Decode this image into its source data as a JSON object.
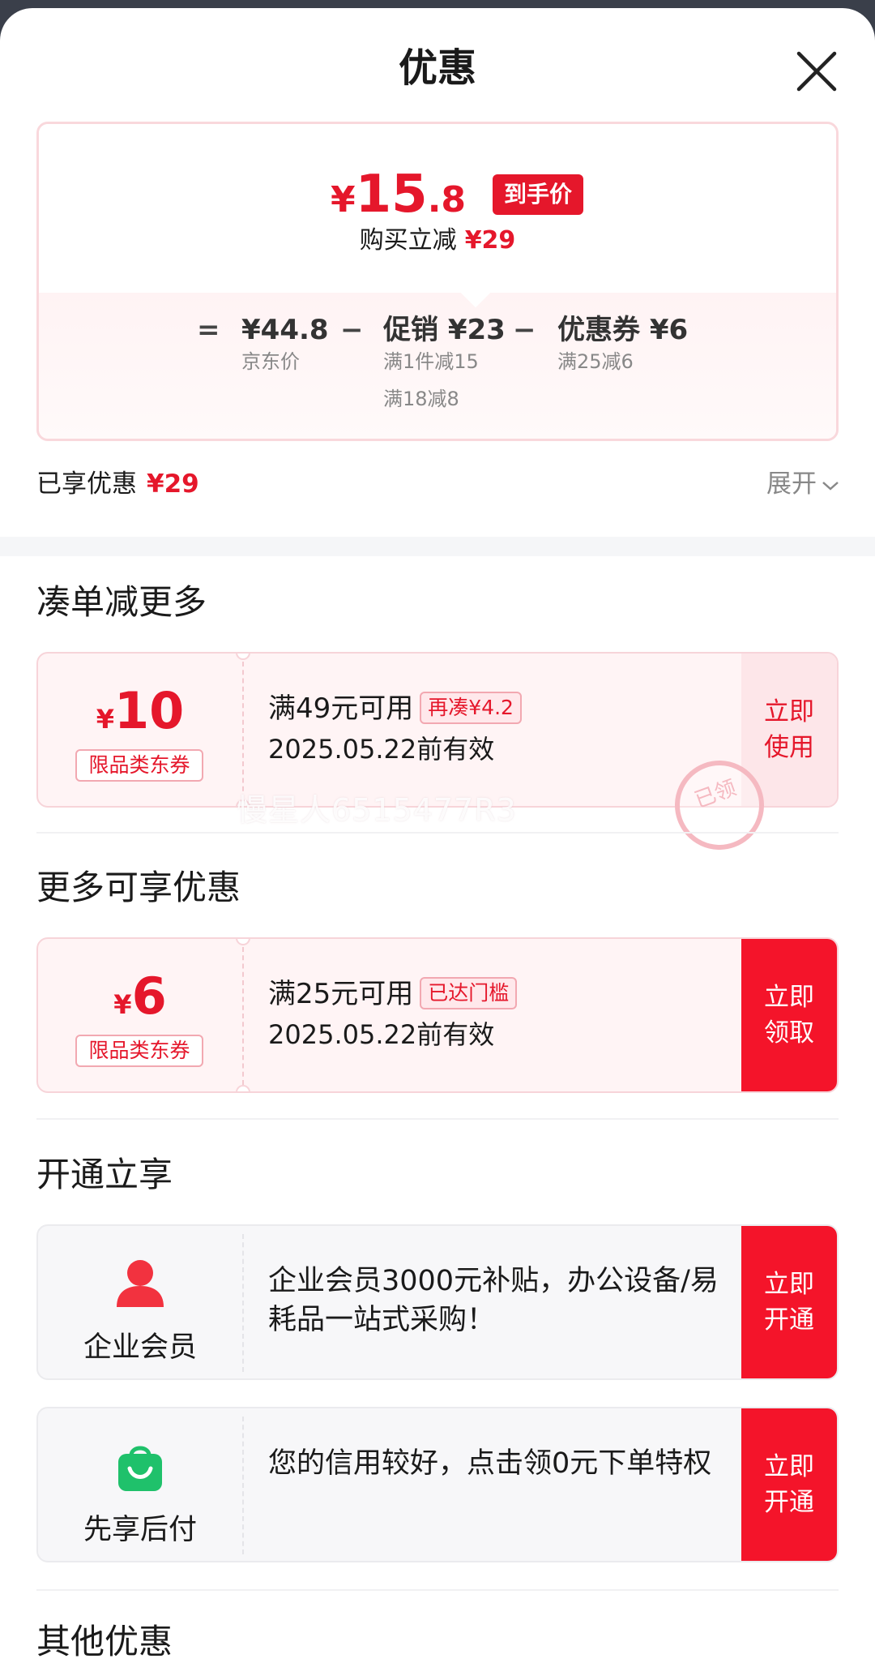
{
  "sheet": {
    "title": "优惠"
  },
  "summary": {
    "currency": "¥",
    "final_int": "15",
    "final_dec": ".8",
    "final_tag": "到手价",
    "reduce_label": "购买立减",
    "reduce_amount": "¥29",
    "formula": {
      "eq": "=",
      "jd_price": "¥44.8",
      "jd_label": "京东价",
      "minus1": "−",
      "promo_label": "促销 ¥23",
      "promo_rule1": "满1件减15",
      "promo_rule2": "满18减8",
      "minus2": "−",
      "coupon_label": "优惠券 ¥6",
      "coupon_rule": "满25减6"
    }
  },
  "enjoyed": {
    "label": "已享优惠",
    "amount": "¥29",
    "expand": "展开"
  },
  "section_combine": {
    "title": "凑单减更多",
    "coupon": {
      "currency": "¥",
      "amount": "10",
      "type": "限品类东券",
      "condition": "满49元可用",
      "tag": "再凑¥4.2",
      "expiry": "2025.05.22前有效",
      "action_line1": "立即",
      "action_line2": "使用",
      "watermark": "慢星人6515477R3",
      "stamp": "已领"
    }
  },
  "section_more": {
    "title": "更多可享优惠",
    "coupon": {
      "currency": "¥",
      "amount": "6",
      "type": "限品类东券",
      "condition": "满25元可用",
      "tag": "已达门槛",
      "expiry": "2025.05.22前有效",
      "action_line1": "立即",
      "action_line2": "领取"
    }
  },
  "section_open": {
    "title": "开通立享",
    "items": [
      {
        "name": "企业会员",
        "desc": " 企业会员3000元补贴，办公设备/易耗品一站式采购！",
        "action_line1": "立即",
        "action_line2": "开通"
      },
      {
        "name": "先享后付",
        "desc": "您的信用较好，点击领0元下单特权",
        "action_line1": "立即",
        "action_line2": "开通"
      }
    ]
  },
  "section_other": {
    "title": "其他优惠"
  },
  "colors": {
    "accent": "#e5172b",
    "action_bg": "#f4142a",
    "card_bg": "#fff4f5",
    "page_bg": "#ffffff"
  }
}
